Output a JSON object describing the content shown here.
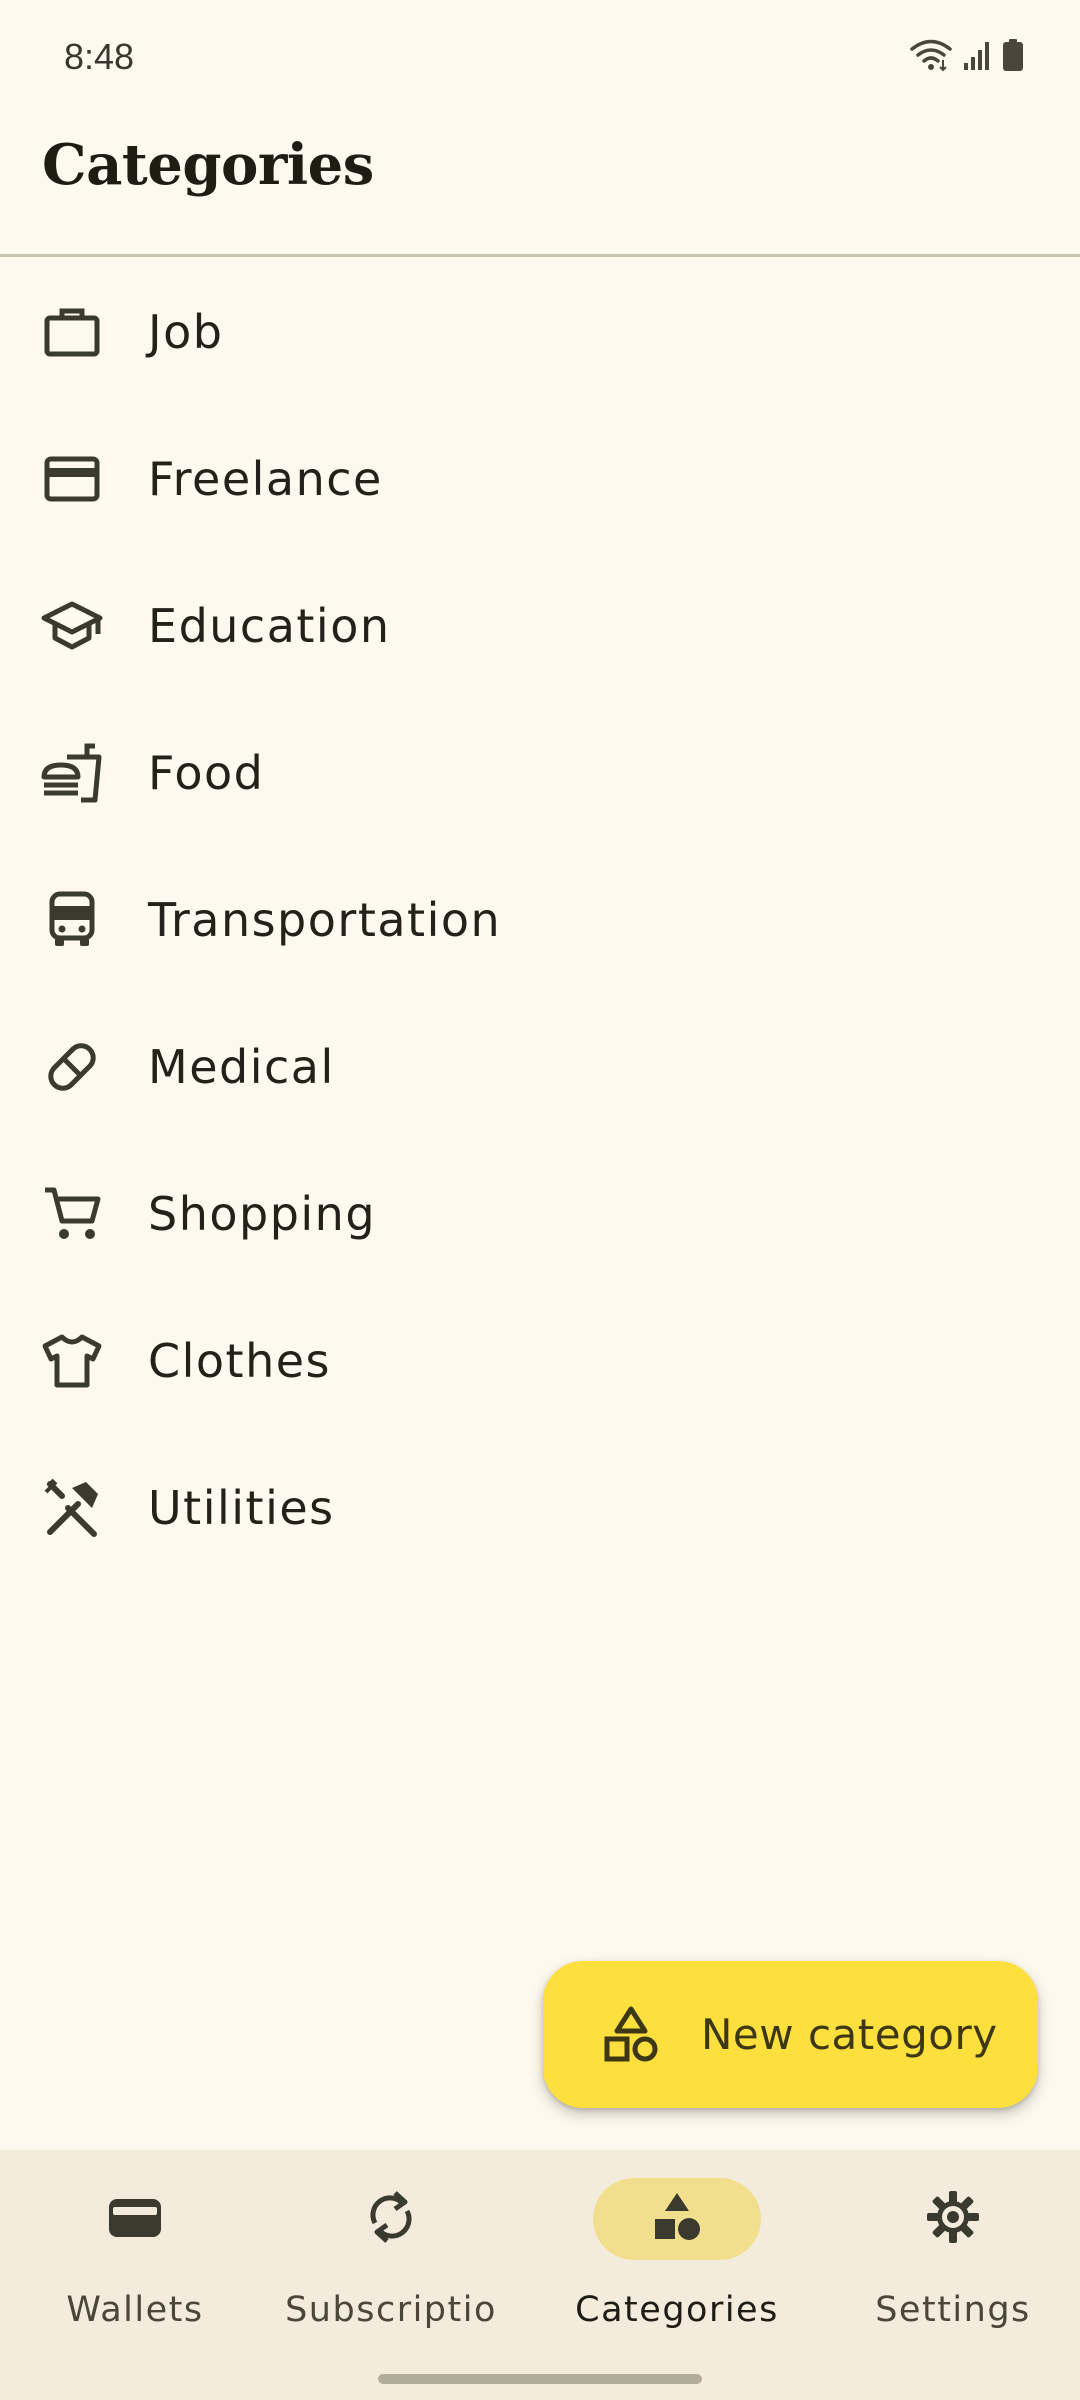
{
  "status_bar": {
    "time": "8:48",
    "icons": [
      "wifi-icon",
      "signal-icon",
      "battery-icon"
    ]
  },
  "header": {
    "title": "Categories"
  },
  "categories": [
    {
      "label": "Job",
      "icon": "briefcase-icon"
    },
    {
      "label": "Freelance",
      "icon": "credit-card-icon"
    },
    {
      "label": "Education",
      "icon": "graduation-cap-icon"
    },
    {
      "label": "Food",
      "icon": "fastfood-icon"
    },
    {
      "label": "Transportation",
      "icon": "bus-icon"
    },
    {
      "label": "Medical",
      "icon": "pill-icon"
    },
    {
      "label": "Shopping",
      "icon": "shopping-cart-icon"
    },
    {
      "label": "Clothes",
      "icon": "tshirt-icon"
    },
    {
      "label": "Utilities",
      "icon": "tools-icon"
    }
  ],
  "fab": {
    "label": "New category",
    "icon": "shapes-icon"
  },
  "bottom_nav": {
    "items": [
      {
        "label": "Wallets",
        "icon": "wallet-icon",
        "active": false
      },
      {
        "label": "Subscriptio",
        "icon": "sync-icon",
        "active": false
      },
      {
        "label": "Categories",
        "icon": "shapes-filled-icon",
        "active": true
      },
      {
        "label": "Settings",
        "icon": "gear-icon",
        "active": false
      }
    ]
  },
  "colors": {
    "background": "#FDF9EE",
    "fab": "#FDDF3D",
    "nav_background": "#F3ECDD",
    "nav_active_pill": "#F2DF8E",
    "icon": "#3B3A2E"
  }
}
